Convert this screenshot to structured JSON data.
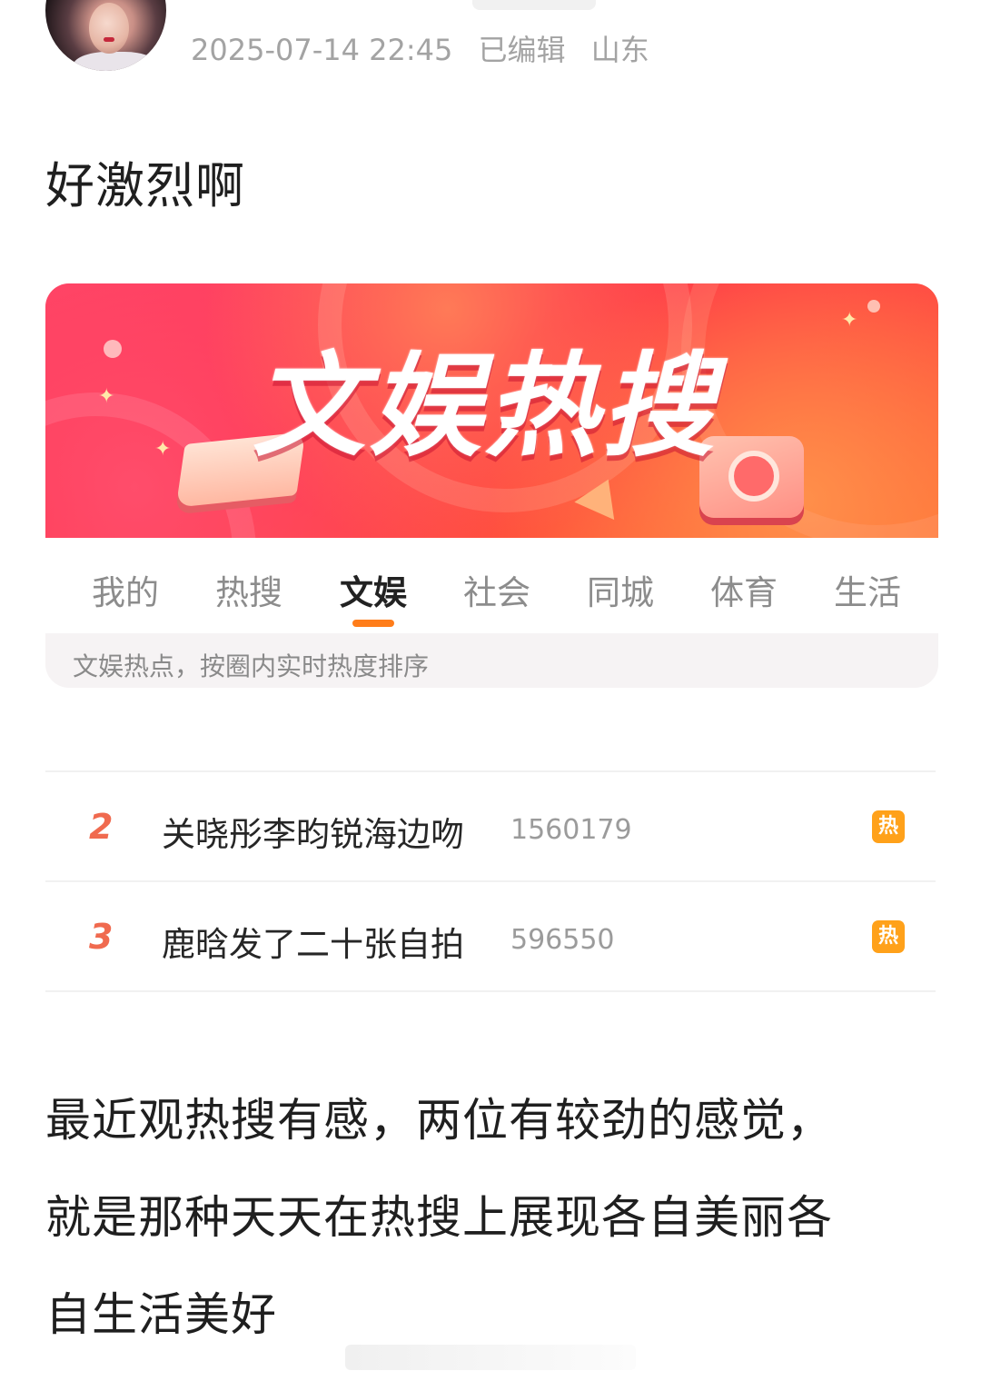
{
  "post": {
    "timestamp": "2025-07-14 22:45",
    "edited_label": "已编辑",
    "location": "山东",
    "intro": "好激烈啊",
    "body_lines": [
      "最近观热搜有感，两位有较劲的感觉，",
      "就是那种天天在热搜上展现各自美丽各",
      "自生活美好"
    ]
  },
  "card": {
    "banner_title": "文娱热搜",
    "tabs": [
      {
        "label": "我的"
      },
      {
        "label": "热搜"
      },
      {
        "label": "文娱"
      },
      {
        "label": "社会"
      },
      {
        "label": "同城"
      },
      {
        "label": "体育"
      },
      {
        "label": "生活"
      }
    ],
    "active_tab": "文娱",
    "subtitle": "文娱热点，按圈内实时热度排序"
  },
  "hot_list": [
    {
      "rank": "2",
      "topic": "关晓彤李昀锐海边吻",
      "heat": "1560179",
      "badge": "热"
    },
    {
      "rank": "3",
      "topic": "鹿晗发了二十张自拍",
      "heat": "596550",
      "badge": "热"
    }
  ],
  "colors": {
    "accent": "#ff7d1a",
    "rank": "#f06a4f",
    "hot_badge": "#ffa11a",
    "banner": "#ff2b47"
  }
}
